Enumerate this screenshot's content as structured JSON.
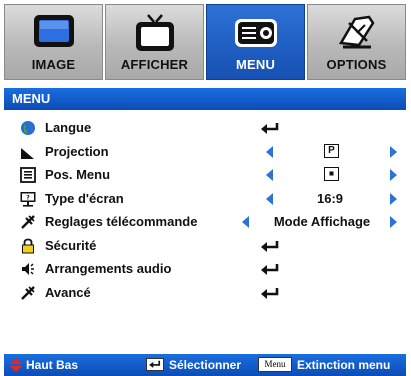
{
  "tabs": [
    {
      "label": "IMAGE",
      "icon": "monitor-icon",
      "active": false
    },
    {
      "label": "AFFICHER",
      "icon": "tv-icon",
      "active": false
    },
    {
      "label": "MENU",
      "icon": "projector-icon",
      "active": true
    },
    {
      "label": "OPTIONS",
      "icon": "tools-icon",
      "active": false
    }
  ],
  "header": {
    "title": "MENU"
  },
  "rows": [
    {
      "label": "Langue",
      "icon": "globe-icon",
      "control": "enter"
    },
    {
      "label": "Projection",
      "icon": "projection-icon",
      "control": "select",
      "value": "P"
    },
    {
      "label": "Pos. Menu",
      "icon": "menu-position-icon",
      "control": "select",
      "value": ""
    },
    {
      "label": "Type d'écran",
      "icon": "screen-type-icon",
      "control": "select",
      "value": "16:9"
    },
    {
      "label": "Reglages télécommande",
      "icon": "remote-icon",
      "control": "select",
      "value": "Mode Affichage"
    },
    {
      "label": "Sécurité",
      "icon": "lock-icon",
      "control": "enter"
    },
    {
      "label": "Arrangements audio",
      "icon": "speaker-icon",
      "control": "enter"
    },
    {
      "label": "Avancé",
      "icon": "advanced-icon",
      "control": "enter"
    }
  ],
  "footer": {
    "nav_label": "Haut Bas",
    "select_label": "Sélectionner",
    "menu_key": "Menu",
    "exit_label": "Extinction menu"
  },
  "colors": {
    "accent": "#1a6ee0",
    "arrow": "#2a73d8"
  }
}
